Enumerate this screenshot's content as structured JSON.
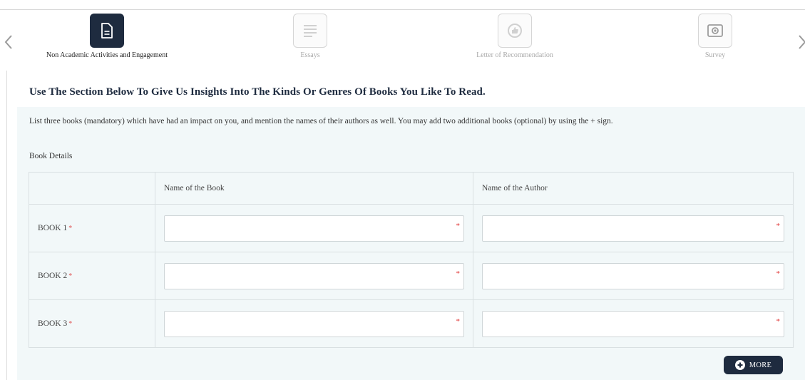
{
  "steps": [
    {
      "label": "Non Academic Activities and Engagement",
      "icon": "document-icon",
      "active": true
    },
    {
      "label": "Essays",
      "icon": "text-lines-icon",
      "active": false
    },
    {
      "label": "Letter of Recommendation",
      "icon": "thumbs-up-icon",
      "active": false
    },
    {
      "label": "Survey",
      "icon": "survey-icon",
      "active": false
    }
  ],
  "section": {
    "title": "Use The Section Below To Give Us Insights Into The Kinds Or Genres Of Books You Like To Read.",
    "instructions": "List three books (mandatory) which have had an impact on you, and mention the names of their authors as well. You may add two additional books (optional) by using the + sign.",
    "details_label": "Book Details"
  },
  "table": {
    "headers": [
      "",
      "Name of the Book",
      "Name of the Author"
    ],
    "rows": [
      {
        "label": "BOOK 1",
        "required_mark": "*",
        "book_value": "",
        "author_value": ""
      },
      {
        "label": "BOOK 2",
        "required_mark": "*",
        "book_value": "",
        "author_value": ""
      },
      {
        "label": "BOOK 3",
        "required_mark": "*",
        "book_value": "",
        "author_value": ""
      }
    ],
    "field_required_mark": "*"
  },
  "more_button": {
    "label": "MORE",
    "icon": "plus-circle-icon"
  },
  "colors": {
    "accent": "#1e2b3f",
    "panel": "#f2f8f9",
    "required": "#e03535"
  }
}
